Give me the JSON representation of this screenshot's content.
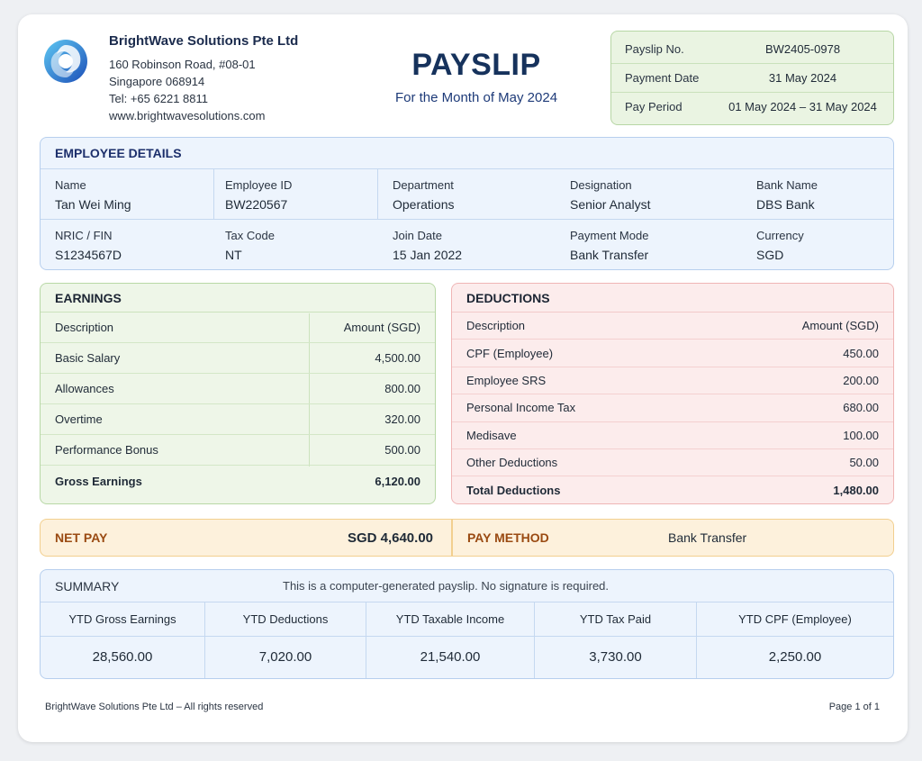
{
  "company": {
    "name": "BrightWave Solutions Pte Ltd",
    "address_line1": "160 Robinson Road, #08-01",
    "address_line2": "Singapore 068914",
    "tel": "Tel: +65 6221 8811",
    "website": "www.brightwavesolutions.com",
    "logo_icon": "swirl-logo-icon"
  },
  "title": {
    "main": "PAYSLIP",
    "subtitle": "For the Month of May 2024"
  },
  "meta": [
    {
      "label": "Payslip No.",
      "value": "BW2405-0978"
    },
    {
      "label": "Payment Date",
      "value": "31 May 2024"
    },
    {
      "label": "Pay Period",
      "value": "01 May 2024 – 31 May 2024"
    }
  ],
  "employee": {
    "heading": "EMPLOYEE DETAILS",
    "row1": [
      {
        "label": "Name",
        "value": "Tan Wei Ming"
      },
      {
        "label": "Employee ID",
        "value": "BW220567"
      },
      {
        "label": "Department",
        "value": "Operations"
      },
      {
        "label": "Designation",
        "value": "Senior Analyst"
      },
      {
        "label": "Bank Name",
        "value": "DBS Bank"
      }
    ],
    "row2": [
      {
        "label": "NRIC / FIN",
        "value": "S1234567D"
      },
      {
        "label": "Tax Code",
        "value": "NT"
      },
      {
        "label": "Join Date",
        "value": "15 Jan 2022"
      },
      {
        "label": "Payment Mode",
        "value": "Bank Transfer"
      },
      {
        "label": "Currency",
        "value": "SGD"
      }
    ]
  },
  "earnings": {
    "heading": "EARNINGS",
    "col_desc": "Description",
    "col_amount": "Amount (SGD)",
    "items": [
      {
        "desc": "Basic Salary",
        "amount": "4,500.00"
      },
      {
        "desc": "Allowances",
        "amount": "800.00"
      },
      {
        "desc": "Overtime",
        "amount": "320.00"
      },
      {
        "desc": "Performance Bonus",
        "amount": "500.00"
      }
    ],
    "total_label": "Gross Earnings",
    "total_amount": "6,120.00"
  },
  "deductions": {
    "heading": "DEDUCTIONS",
    "col_desc": "Description",
    "col_amount": "Amount (SGD)",
    "items": [
      {
        "desc": "CPF (Employee)",
        "amount": "450.00"
      },
      {
        "desc": "Employee SRS",
        "amount": "200.00"
      },
      {
        "desc": "Personal Income Tax",
        "amount": "680.00"
      },
      {
        "desc": "Medisave",
        "amount": "100.00"
      },
      {
        "desc": "Other Deductions",
        "amount": "50.00"
      }
    ],
    "total_label": "Total Deductions",
    "total_amount": "1,480.00"
  },
  "net_pay": {
    "label": "NET PAY",
    "value": "SGD 4,640.00"
  },
  "pay_method": {
    "label": "PAY METHOD",
    "value": "Bank Transfer"
  },
  "summary": {
    "heading": "SUMMARY",
    "note": "This is a computer-generated payslip. No signature is required.",
    "items": [
      {
        "label": "YTD Gross Earnings",
        "value": "28,560.00"
      },
      {
        "label": "YTD Deductions",
        "value": "7,020.00"
      },
      {
        "label": "YTD Taxable Income",
        "value": "21,540.00"
      },
      {
        "label": "YTD Tax Paid",
        "value": "3,730.00"
      },
      {
        "label": "YTD CPF (Employee)",
        "value": "2,250.00"
      }
    ]
  },
  "footer": {
    "left": "BrightWave Solutions Pte Ltd – All rights reserved",
    "right": "Page 1 of 1"
  },
  "colors": {
    "brand_navy": "#16325c",
    "earnings_bg": "#eef6e8",
    "deductions_bg": "#fcecec",
    "netpay_bg": "#fdf1dc",
    "details_bg": "#edf4fd"
  }
}
